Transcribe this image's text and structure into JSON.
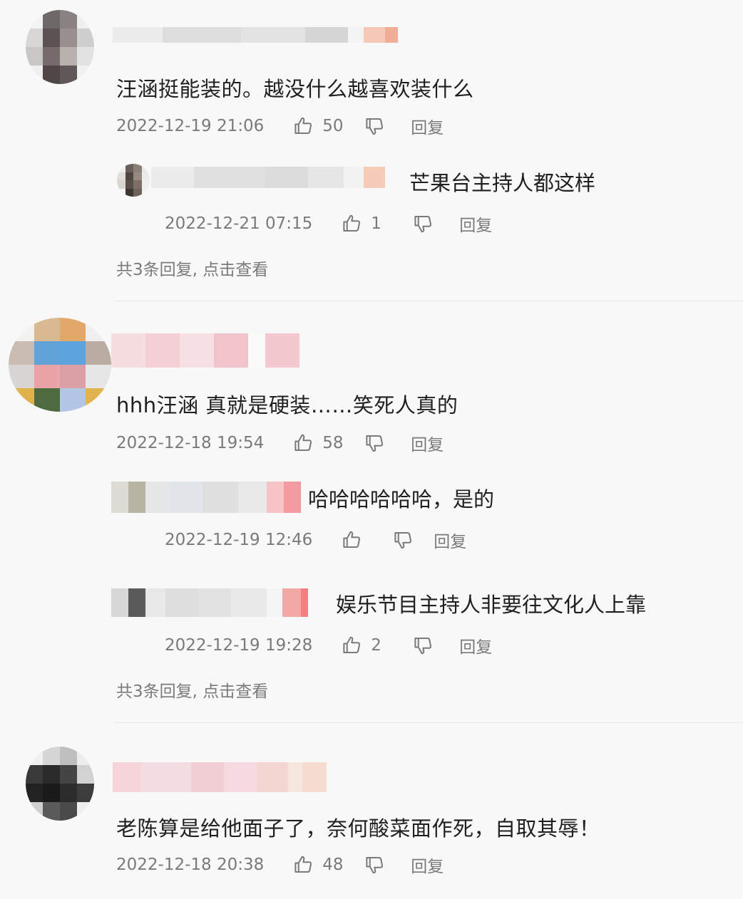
{
  "comments": [
    {
      "text": "汪涵挺能装的。越没什么越喜欢装什么",
      "time": "2022-12-19 21:06",
      "likes": "50",
      "reply_label": "回复",
      "replies": [
        {
          "text": "芒果台主持人都这样",
          "time": "2022-12-21 07:15",
          "likes": "1",
          "reply_label": "回复"
        }
      ],
      "view_more": "共3条回复, 点击查看"
    },
    {
      "text": "hhh汪涵 真就是硬装……笑死人真的",
      "time": "2022-12-18 19:54",
      "likes": "58",
      "reply_label": "回复",
      "replies": [
        {
          "text": "哈哈哈哈哈哈，是的",
          "time": "2022-12-19 12:46",
          "likes": "",
          "reply_label": "回复"
        },
        {
          "text": "娱乐节目主持人非要往文化人上靠",
          "time": "2022-12-19 19:28",
          "likes": "2",
          "reply_label": "回复"
        }
      ],
      "view_more": "共3条回复, 点击查看"
    },
    {
      "text": "老陈算是给他面子了，奈何酸菜面作死，自取其辱！",
      "time": "2022-12-18 20:38",
      "likes": "48",
      "reply_label": "回复"
    }
  ],
  "colors": {
    "text": "#1f1f1f",
    "meta": "#7a7a7a",
    "background": "#f8f8f8"
  },
  "icons": [
    "thumbs-up-icon",
    "thumbs-down-icon"
  ]
}
